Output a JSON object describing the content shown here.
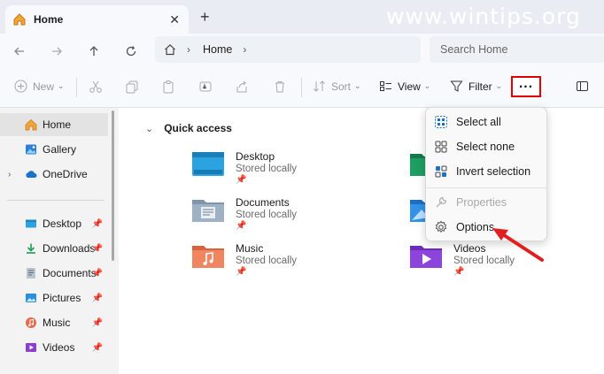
{
  "tab": {
    "title": "Home",
    "close": "✕",
    "new": "+"
  },
  "watermark": "www.wintips.org",
  "address": {
    "crumb": "Home",
    "chevron": "›"
  },
  "search": {
    "placeholder": "Search Home"
  },
  "toolbar": {
    "new_label": "New",
    "sort_label": "Sort",
    "view_label": "View",
    "filter_label": "Filter",
    "more_label": "...",
    "caret": "⌄"
  },
  "sidebar": {
    "items": [
      {
        "label": "Home"
      },
      {
        "label": "Gallery"
      },
      {
        "label": "OneDrive"
      },
      {
        "label": "Desktop"
      },
      {
        "label": "Downloads"
      },
      {
        "label": "Documents"
      },
      {
        "label": "Pictures"
      },
      {
        "label": "Music"
      },
      {
        "label": "Videos"
      }
    ]
  },
  "main": {
    "section_title": "Quick access",
    "folders": [
      {
        "name": "Desktop",
        "status": "Stored locally"
      },
      {
        "name": "Documents",
        "status": "Stored locally"
      },
      {
        "name": "Music",
        "status": "Stored locally"
      },
      {
        "name": "Videos",
        "status": "Stored locally"
      }
    ]
  },
  "menu": {
    "items": [
      {
        "label": "Select all"
      },
      {
        "label": "Select none"
      },
      {
        "label": "Invert selection"
      },
      {
        "label": "Properties"
      },
      {
        "label": "Options"
      }
    ]
  },
  "colors": {
    "highlight": "#e00000",
    "arrow": "#e02020",
    "folder_yellow": "#f2b632",
    "accent": "#1a73c9"
  }
}
